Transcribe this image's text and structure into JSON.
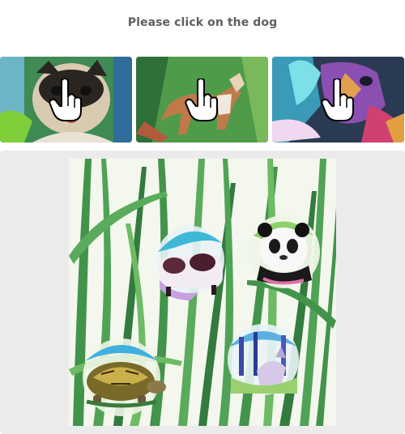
{
  "prompt": {
    "text": "Please click on the dog"
  },
  "examples": [
    {
      "subject": "dog-portrait-icon",
      "cursor": "hand-pointer-icon"
    },
    {
      "subject": "dog-walking-icon",
      "cursor": "hand-pointer-icon"
    },
    {
      "subject": "colorful-dog-icon",
      "cursor": "hand-pointer-icon"
    }
  ],
  "scene": {
    "background": "green-grass-watercolor",
    "targets": [
      {
        "animal": "cow-icon"
      },
      {
        "animal": "panda-icon"
      },
      {
        "animal": "turtle-icon"
      },
      {
        "animal": "forest-animal-icon"
      }
    ]
  },
  "colors": {
    "prompt_text": "#5f5f5f",
    "panel_bg": "#ebebeb",
    "grass": "#2f8a3a"
  }
}
